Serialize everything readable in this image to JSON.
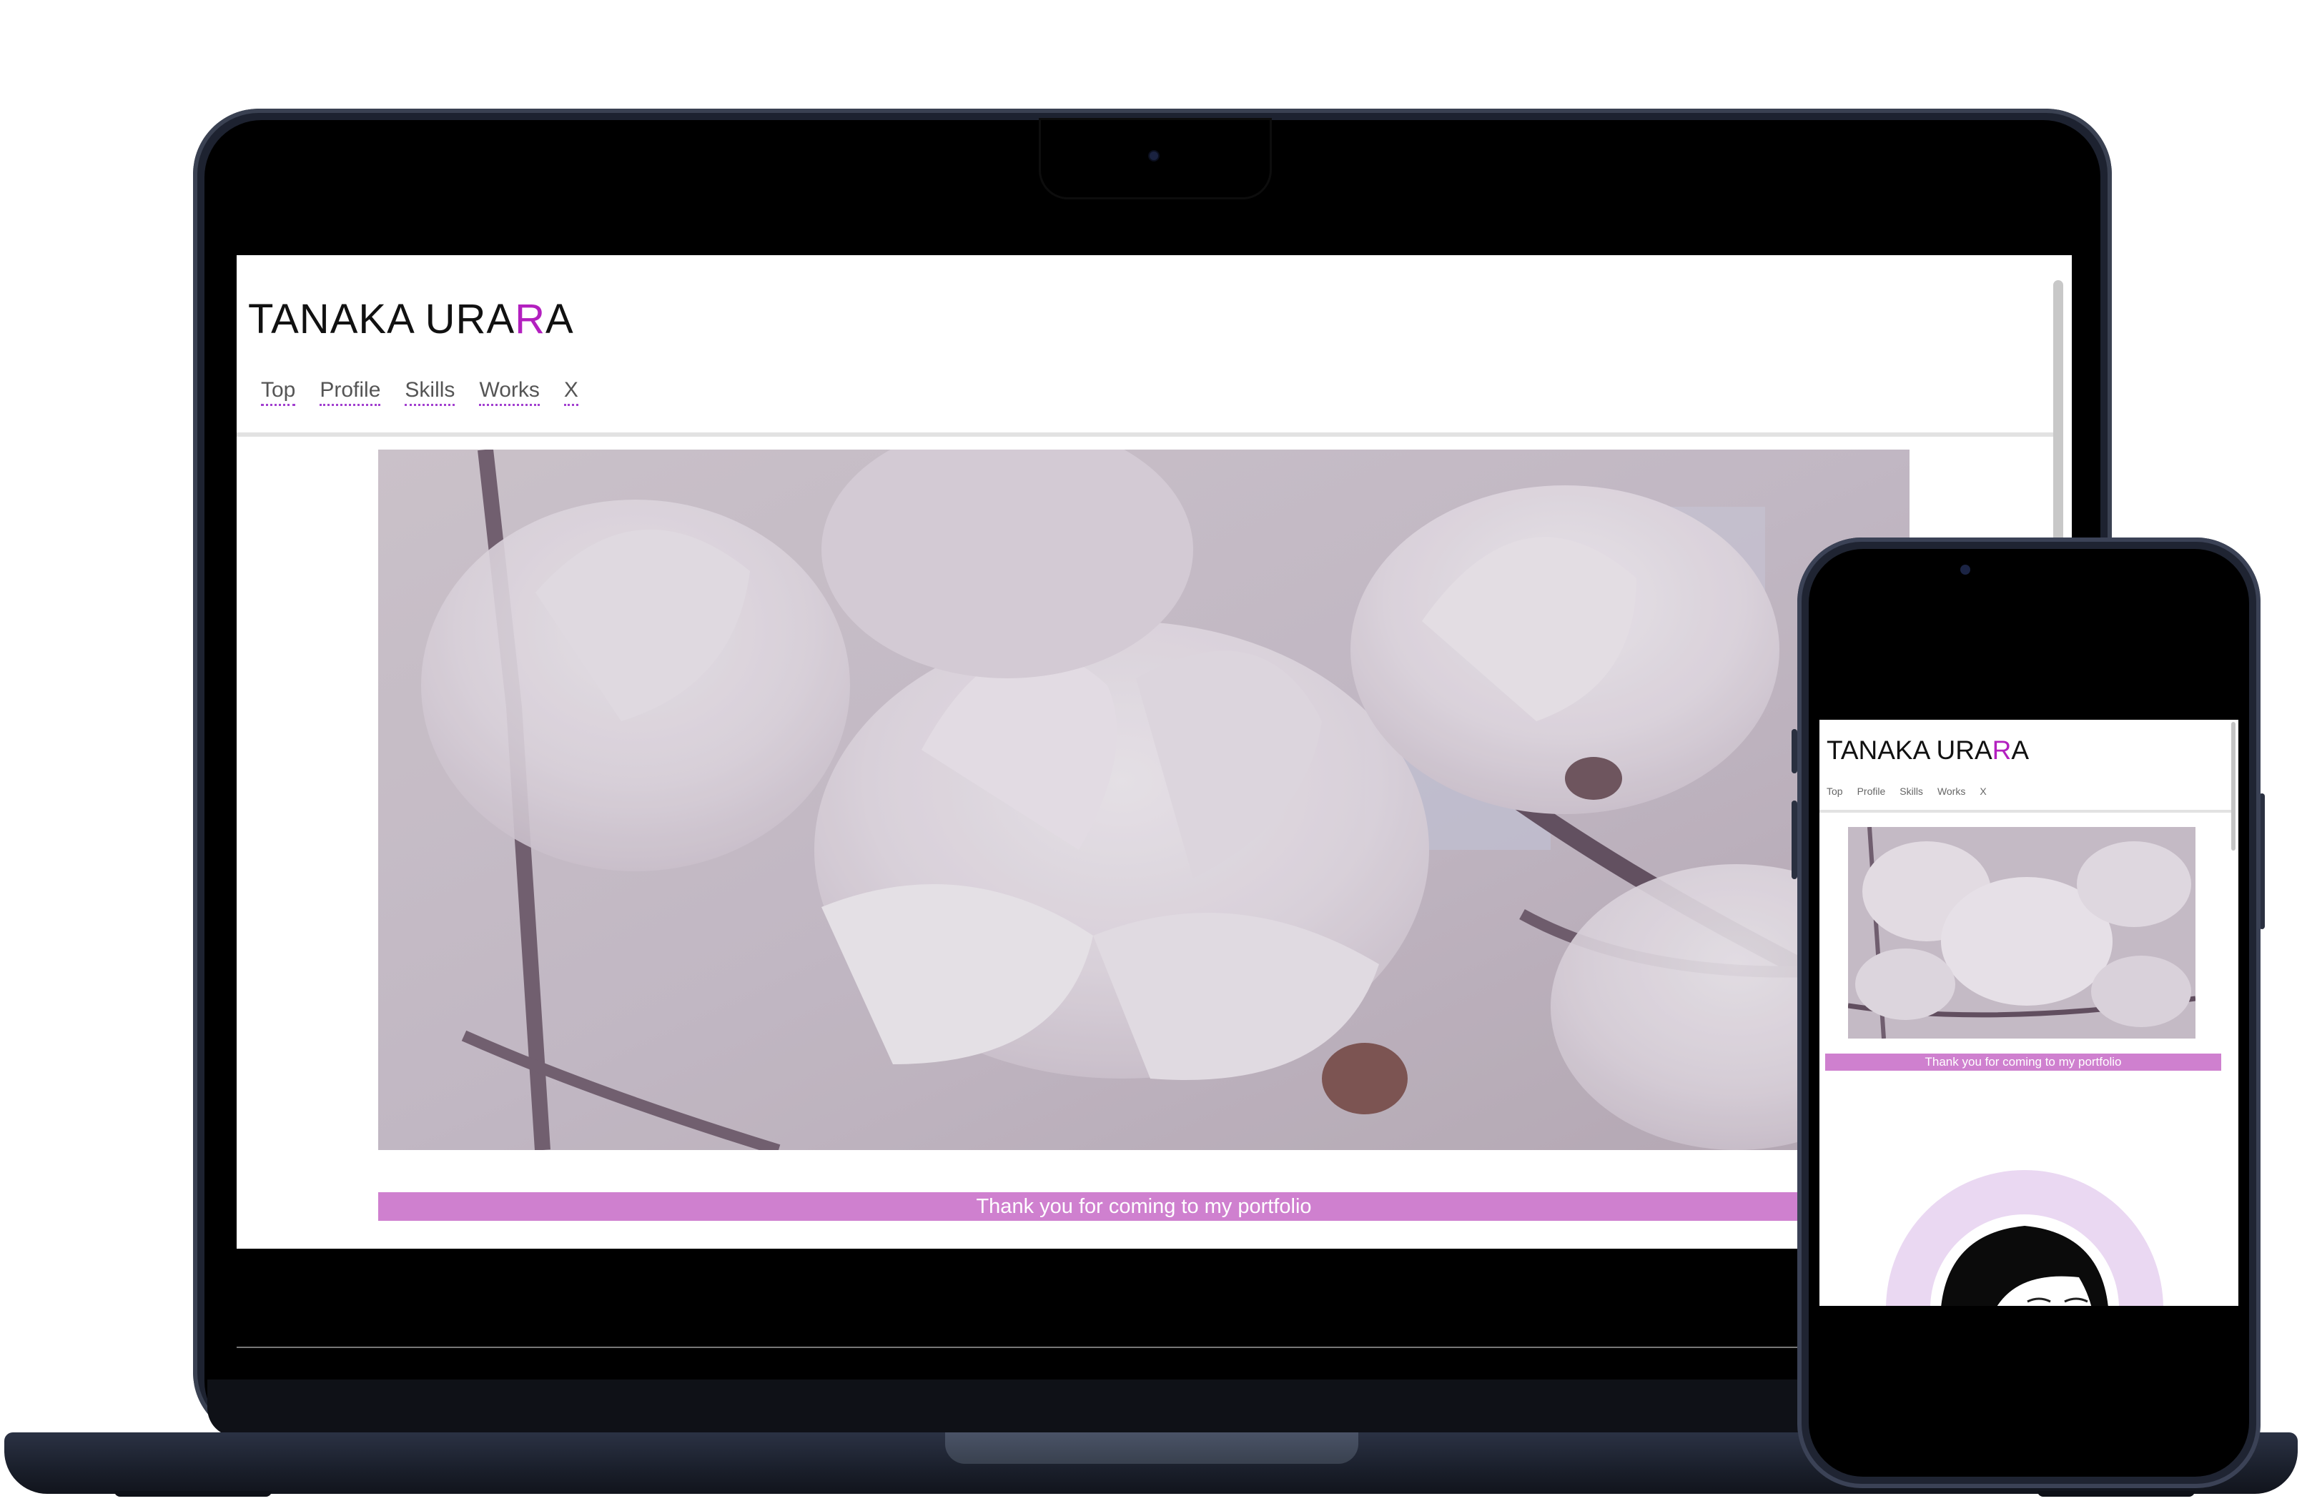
{
  "site": {
    "logo_main": "TANAKA URA",
    "logo_accent": "R",
    "logo_end": "A",
    "nav": [
      "Top",
      "Profile",
      "Skills",
      "Works",
      "X"
    ],
    "banner": "Thank you for coming to my portfolio"
  },
  "colors": {
    "accent": "#b320bf",
    "banner_bg": "#cf80cf",
    "nav_underline": "#a23fd0",
    "device_frame": "#1f2432",
    "profile_ring": "#ead8f2"
  },
  "icons": {
    "hero": "magnolia-flower-photo",
    "profile": "profile-avatar-illustration"
  }
}
